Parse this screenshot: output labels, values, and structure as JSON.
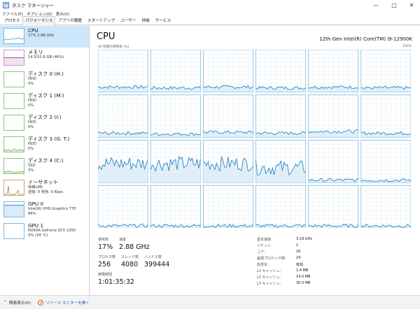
{
  "window": {
    "title": "タスク マネージャー",
    "minimize": "—",
    "maximize": "□",
    "close": "✕"
  },
  "menu": [
    "ファイル(F)",
    "オプション(O)",
    "表示(V)"
  ],
  "tabs": [
    "プロセス",
    "パフォーマンス",
    "アプリの履歴",
    "スタートアップ",
    "ユーザー",
    "詳細",
    "サービス"
  ],
  "active_tab": 1,
  "sidebar": {
    "items": [
      {
        "title": "CPU",
        "sub1": "17%  2.88 GHz",
        "sub2": "",
        "color": "#3d8ec9",
        "icon": "cpu-graph-icon"
      },
      {
        "title": "メモリ",
        "sub1": "14.5/31.8 GB (46%)",
        "sub2": "",
        "color": "#a54ea5",
        "icon": "memory-graph-icon"
      },
      {
        "title": "ディスク 0 (H:)",
        "sub1": "HDD",
        "sub2": "0%",
        "color": "#5cac3c",
        "icon": "disk-graph-icon"
      },
      {
        "title": "ディスク 1 (M:)",
        "sub1": "HDD",
        "sub2": "0%",
        "color": "#5cac3c",
        "icon": "disk-graph-icon"
      },
      {
        "title": "ディスク 2 (I:)",
        "sub1": "HDD",
        "sub2": "0%",
        "color": "#5cac3c",
        "icon": "disk-graph-icon"
      },
      {
        "title": "ディスク 3 (G: T:)",
        "sub1": "HDD",
        "sub2": "5%",
        "color": "#5cac3c",
        "icon": "disk-graph-icon"
      },
      {
        "title": "ディスク 4 (C:)",
        "sub1": "SSD",
        "sub2": "3%",
        "color": "#5cac3c",
        "icon": "disk-graph-icon"
      },
      {
        "title": "イーサネット",
        "sub1": "有線LAN",
        "sub2": "送信: 0 受信: 0 Kbps",
        "color": "#a3722c",
        "icon": "ethernet-graph-icon"
      },
      {
        "title": "GPU 0",
        "sub1": "Intel(R) UHD Graphics 770",
        "sub2": "84%",
        "color": "#3d8ec9",
        "icon": "gpu-graph-icon"
      },
      {
        "title": "GPU 1",
        "sub1": "NVIDIA GeForce GTX 1050",
        "sub2": "0% (34 °C)",
        "color": "#3d8ec9",
        "icon": "gpu-graph-icon"
      }
    ]
  },
  "main": {
    "title": "CPU",
    "model": "12th Gen Intel(R) Core(TM) i9-12900K",
    "util_label": "60 秒間の使用率 (%)",
    "util_max": "100%",
    "accent": "#117dbb",
    "stats": {
      "usage_label": "使用率",
      "usage_value": "17%",
      "speed_label": "速度",
      "speed_value": "2.88 GHz",
      "process_label": "プロセス数",
      "process_value": "256",
      "thread_label": "スレッド数",
      "thread_value": "4080",
      "handle_label": "ハンドル数",
      "handle_value": "399444",
      "uptime_label": "稼働時間",
      "uptime_value": "1:01:35:32"
    },
    "specs": [
      {
        "k": "基本速度:",
        "v": "3.19 GHz"
      },
      {
        "k": "ソケット:",
        "v": "1"
      },
      {
        "k": "コア:",
        "v": "16"
      },
      {
        "k": "論理プロセッサ数:",
        "v": "24"
      },
      {
        "k": "仮想化:",
        "v": "有効"
      },
      {
        "k": "L1 キャッシュ:",
        "v": "1.4 MB"
      },
      {
        "k": "L2 キャッシュ:",
        "v": "14.0 MB"
      },
      {
        "k": "L3 キャッシュ:",
        "v": "30.0 MB"
      }
    ]
  },
  "footer": {
    "collapse_label": "簡易表示(D)",
    "monitor_label": "リソース モニターを開く"
  }
}
